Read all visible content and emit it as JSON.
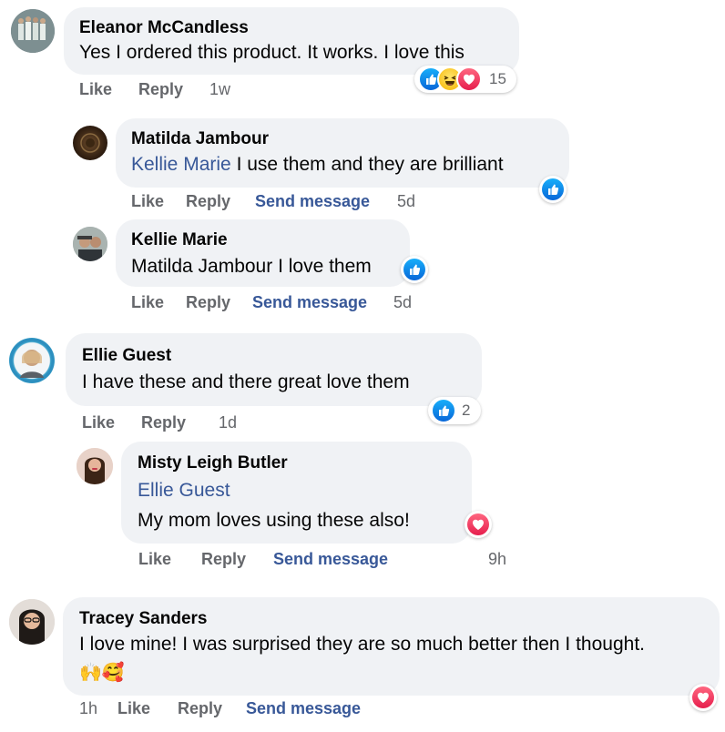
{
  "actions": {
    "like": "Like",
    "reply": "Reply",
    "send_message": "Send message"
  },
  "comments": [
    {
      "author": "Eleanor McCandless",
      "text": "Yes I ordered this product. It works. I love this",
      "time": "1w",
      "reactions": [
        "like-icon",
        "haha-icon",
        "love-icon"
      ],
      "reaction_count": "15"
    },
    {
      "author": "Matilda Jambour",
      "mention": "Kellie Marie",
      "text": "I use them and they are brilliant",
      "time": "5d",
      "reactions": [
        "like-icon"
      ]
    },
    {
      "author": "Kellie Marie",
      "text": "Matilda Jambour I love them",
      "time": "5d",
      "reactions": [
        "like-icon"
      ]
    },
    {
      "author": "Ellie Guest",
      "text": "I have these and there great love them",
      "time": "1d",
      "reactions": [
        "like-icon"
      ],
      "reaction_count": "2"
    },
    {
      "author": "Misty Leigh Butler",
      "mention": "Ellie Guest",
      "text": "My mom loves using these also!",
      "time": "9h",
      "reactions": [
        "love-icon"
      ]
    },
    {
      "author": "Tracey Sanders",
      "text": "I love mine! I was surprised they are so much better then I thought.",
      "emoji": "🙌🥰",
      "time": "1h",
      "reactions": [
        "love-icon"
      ]
    }
  ]
}
